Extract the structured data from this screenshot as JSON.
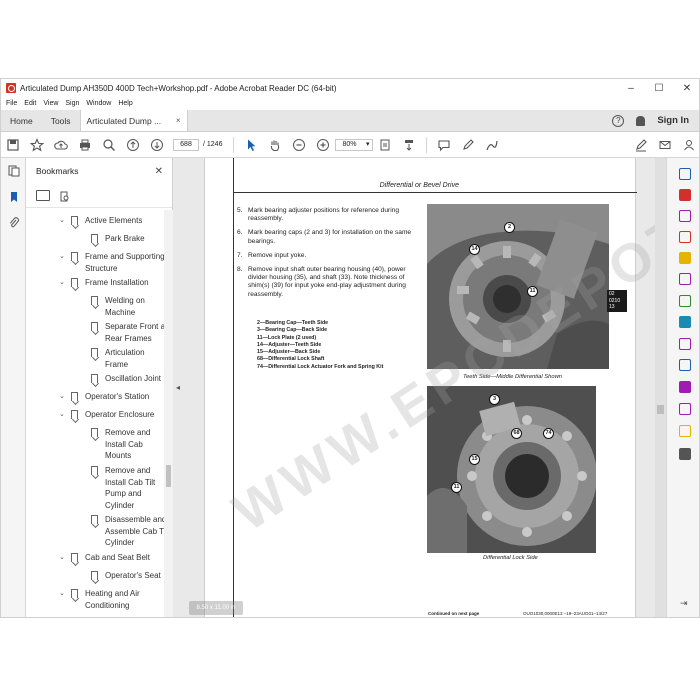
{
  "window": {
    "title": "Articulated Dump AH350D 400D Tech+Workshop.pdf - Adobe Acrobat Reader DC (64-bit)",
    "controls": [
      "–",
      "☐",
      "✕"
    ]
  },
  "menu": [
    "File",
    "Edit",
    "View",
    "Sign",
    "Window",
    "Help"
  ],
  "tabs": {
    "home": "Home",
    "tools": "Tools",
    "document": "Articulated Dump ...",
    "close": "×",
    "sign_in": "Sign In",
    "help": "?"
  },
  "toolbar": {
    "page_current": "688",
    "page_total": "/ 1246",
    "zoom": "80%"
  },
  "bookmarks": {
    "title": "Bookmarks",
    "close": "✕",
    "items": [
      {
        "label": "Active Elements",
        "chev": "⌄"
      },
      {
        "label": "Park Brake",
        "chev": ""
      },
      {
        "label": "Frame and Supporting Structure",
        "chev": "⌄"
      },
      {
        "label": "Frame Installation",
        "chev": "⌄"
      },
      {
        "label": "Welding on Machine",
        "chev": ""
      },
      {
        "label": "Separate Front and Rear Frames",
        "chev": ""
      },
      {
        "label": "Articulation Frame",
        "chev": ""
      },
      {
        "label": "Oscillation Joint",
        "chev": ""
      },
      {
        "label": "Operator's Station",
        "chev": "⌄"
      },
      {
        "label": "Operator Enclosure",
        "chev": "⌄"
      },
      {
        "label": "Remove and Install Cab Mounts",
        "chev": ""
      },
      {
        "label": "Remove and Install Cab Tilt Pump and Cylinder",
        "chev": ""
      },
      {
        "label": "Disassemble and Assemble Cab Tilt Cylinder",
        "chev": ""
      },
      {
        "label": "Cab and Seat Belt",
        "chev": "⌄"
      },
      {
        "label": "Operator's Seat",
        "chev": ""
      },
      {
        "label": "Heating and Air Conditioning",
        "chev": "⌄"
      }
    ]
  },
  "page": {
    "running_head": "Differential or Bevel Drive",
    "steps": [
      {
        "num": "5.",
        "text": "Mark bearing adjuster positions for reference during reassembly."
      },
      {
        "num": "6.",
        "text": "Mark bearing caps (2 and 3) for installation on the same bearings."
      },
      {
        "num": "7.",
        "text": "Remove input yoke."
      },
      {
        "num": "8.",
        "text": "Remove input shaft outer bearing housing (40), power divider housing (35), and shaft (33). Note thickness of shim(s) (39) for input yoke end-play adjustment during reassembly."
      }
    ],
    "legend": [
      "2—Bearing Cap—Teeth Side",
      "3—Bearing Cap—Back Side",
      "11—Lock Plate (2 used)",
      "14—Adjuster—Teeth Side",
      "15—Adjuster—Back Side",
      "68—Differential Lock Shaft",
      "74—Differential Lock Actuator Fork and Spring Kit"
    ],
    "caption_top": "Teeth Side—Middle Differential Shown",
    "caption_bottom": "Differential Lock Side",
    "side_tab": [
      "02",
      "0210",
      "13"
    ],
    "callouts_top": [
      "2",
      "14",
      "11"
    ],
    "callouts_bottom": [
      "3",
      "68",
      "74",
      "15",
      "11"
    ],
    "footer_left": "Continued on next page",
    "footer_right": "OUO1030,0000E13 –19–23AUG01–14/27",
    "page_label_float": "8.50 x 11.00 in",
    "watermark": "WWW.EPCDEPOT.COM"
  }
}
